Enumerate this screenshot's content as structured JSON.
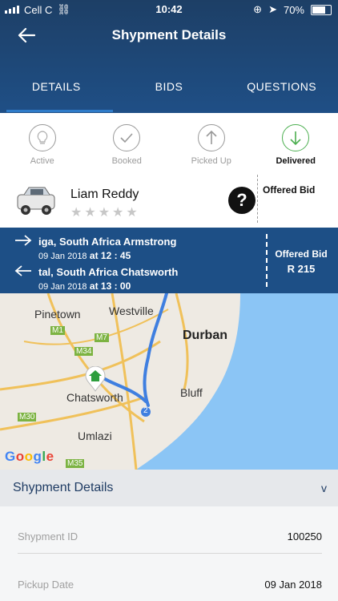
{
  "status_bar": {
    "carrier": "Cell C",
    "time": "10:42",
    "battery": "70%"
  },
  "header": {
    "title": "Shypment Details"
  },
  "tabs": [
    {
      "label": "DETAILS",
      "active": true
    },
    {
      "label": "BIDS",
      "active": false
    },
    {
      "label": "QUESTIONS",
      "active": false
    }
  ],
  "steps": [
    {
      "label": "Active",
      "icon": "bulb-icon"
    },
    {
      "label": "Booked",
      "icon": "check-icon"
    },
    {
      "label": "Picked Up",
      "icon": "arrow-up-icon"
    },
    {
      "label": "Delivered",
      "icon": "arrow-down-icon"
    }
  ],
  "carrier": {
    "name": "Liam Reddy",
    "rating_stars": "★★★★★",
    "rating": 0,
    "offered_bid_label": "Offered Bid"
  },
  "route": {
    "pickup_address": "iga, South Africa Armstrong",
    "pickup_date": "09 Jan 2018",
    "pickup_time": "at 12 : 45",
    "drop_address": "tal, South Africa Chatsworth",
    "drop_date": "09 Jan 2018",
    "drop_time": "at 13 : 00",
    "offered_bid_label": "Offered Bid",
    "offered_bid_amount": "R 215"
  },
  "map": {
    "labels": {
      "westville": "Westville",
      "pinetown": "Pinetown",
      "durban": "Durban",
      "chatsworth": "Chatsworth",
      "bluff": "Bluff",
      "umlazi": "Umlazi",
      "m1": "M1",
      "m7": "M7",
      "m34": "M34",
      "m30": "M30",
      "m35": "M35",
      "route2": "2"
    },
    "google": "Google",
    "colors": {
      "land": "#eeeae3",
      "sea": "#8bc5f5",
      "route": "#3f7fe0",
      "road": "#f0c15a"
    }
  },
  "details": {
    "title": "Shypment Details",
    "chevron": "v",
    "rows": [
      {
        "key": "Shypment ID",
        "value": "100250"
      },
      {
        "key": "Pickup Date",
        "value": "09 Jan 2018"
      }
    ]
  }
}
